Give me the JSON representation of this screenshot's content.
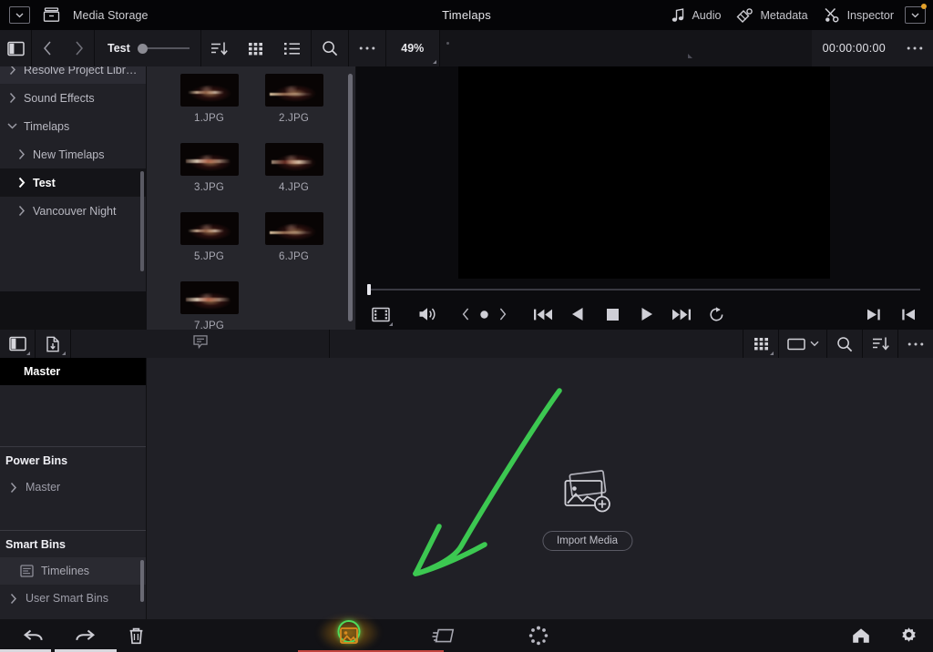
{
  "titlebar": {
    "dropdown_icon": "chevron-down-icon",
    "storage_icon": "media-storage-icon",
    "storage_label": "Media Storage",
    "title": "Timelaps",
    "right_items": [
      {
        "icon": "audio-note-icon",
        "label": "Audio"
      },
      {
        "icon": "metadata-icon",
        "label": "Metadata"
      },
      {
        "icon": "inspector-icon",
        "label": "Inspector"
      }
    ],
    "right_dropdown_icon": "chevron-down-icon",
    "notification_dot_color": "#e3a12a"
  },
  "toolbar_upper": {
    "sidebar_toggle_icon": "sidebar-toggle-icon",
    "back_icon": "chevron-left-icon",
    "forward_icon": "chevron-right-icon",
    "bin_name": "Test",
    "zoom_slider_value": "",
    "sort_icon": "sort-descending-icon",
    "grid_view_icon": "grid-view-icon",
    "list_view_icon": "list-view-icon",
    "search_icon": "search-icon",
    "more_icon": "more-options-icon",
    "zoom_level": "49%",
    "timecode": "00:00:00:00",
    "viewer_more_icon": "more-options-icon"
  },
  "library_tree": {
    "items": [
      {
        "label": "Resolve Project Libra...",
        "arrow": "chevron-right-icon",
        "indent": 1,
        "selected": false,
        "cut_off": true
      },
      {
        "label": "Sound Effects",
        "arrow": "chevron-right-icon",
        "indent": 1,
        "selected": false
      },
      {
        "label": "Timelaps",
        "arrow": "chevron-down-icon",
        "indent": 1,
        "selected": false
      },
      {
        "label": "New Timelaps",
        "arrow": "chevron-right-icon",
        "indent": 2,
        "selected": false
      },
      {
        "label": "Test",
        "arrow": "chevron-right-icon",
        "indent": 2,
        "selected": true
      },
      {
        "label": "Vancouver Night",
        "arrow": "chevron-right-icon",
        "indent": 2,
        "selected": false
      }
    ]
  },
  "thumbnails": {
    "rows": [
      [
        {
          "label": "1.JPG"
        },
        {
          "label": "2.JPG"
        }
      ],
      [
        {
          "label": "3.JPG"
        },
        {
          "label": "4.JPG"
        }
      ],
      [
        {
          "label": "5.JPG"
        },
        {
          "label": "6.JPG"
        }
      ],
      [
        {
          "label": "7.JPG"
        }
      ]
    ]
  },
  "viewer": {
    "transport": [
      {
        "icon": "film-strip-icon",
        "name": "timeline-view-button"
      },
      {
        "icon": "volume-icon",
        "name": "volume-button"
      },
      {
        "icon": "keyframe-prev-icon",
        "name": "prev-keyframe-button"
      },
      {
        "icon": "keyframe-dot-icon",
        "name": "add-keyframe-button"
      },
      {
        "icon": "keyframe-next-icon",
        "name": "next-keyframe-button"
      },
      {
        "icon": "skip-back-icon",
        "name": "jump-to-start-button"
      },
      {
        "icon": "play-reverse-icon",
        "name": "play-reverse-button"
      },
      {
        "icon": "stop-icon",
        "name": "stop-button"
      },
      {
        "icon": "play-icon",
        "name": "play-button"
      },
      {
        "icon": "skip-forward-icon",
        "name": "jump-to-end-button"
      },
      {
        "icon": "loop-icon",
        "name": "loop-button"
      }
    ],
    "right_controls": [
      {
        "icon": "mark-out-icon",
        "name": "mark-out-button"
      },
      {
        "icon": "mark-in-icon",
        "name": "mark-in-button"
      }
    ]
  },
  "toolbar_mid": {
    "sidebar_toggle_icon": "sidebar-toggle-icon",
    "import_file_icon": "import-file-icon",
    "tag_icon": "tag-bubble-icon",
    "grid_icon": "grid-view-icon",
    "view_mode_icon": "thumbnail-view-icon",
    "view_mode_chevron": "chevron-down-icon",
    "search_icon": "search-icon",
    "sort_icon": "sort-descending-icon",
    "more_icon": "more-options-icon"
  },
  "bins": {
    "master_label": "Master",
    "power_bins_title": "Power Bins",
    "power_bins_items": [
      {
        "label": "Master",
        "arrow": "chevron-right-icon"
      }
    ],
    "smart_bins_title": "Smart Bins",
    "smart_bins_items": [
      {
        "label": "Timelines",
        "icon": "timeline-bin-icon",
        "arrow": ""
      },
      {
        "label": "User Smart Bins",
        "arrow": "chevron-right-icon"
      }
    ]
  },
  "media_pool": {
    "import_icon": "import-media-image-icon",
    "import_label": "Import Media",
    "annotation": {
      "type": "hand-drawn-arrow",
      "color": "#3cc851",
      "direction": "down-left",
      "points_to": "import-media-button"
    }
  },
  "bottombar": {
    "undo_icon": "undo-icon",
    "redo_icon": "redo-icon",
    "delete_icon": "trash-icon",
    "pages": [
      {
        "icon": "media-page-icon",
        "name": "media-page-button",
        "active": true
      },
      {
        "icon": "cut-page-icon",
        "name": "cut-page-button",
        "active": false
      },
      {
        "icon": "color-page-icon",
        "name": "color-page-button",
        "active": false
      }
    ],
    "home_icon": "home-icon",
    "settings_icon": "gear-icon"
  },
  "colors": {
    "panel_bg": "#212127",
    "toolbar_bg": "#1a1a1f",
    "titlebar_bg": "#050507",
    "pool_bg": "#202026",
    "accent_green": "#3cc851",
    "accent_orange": "#e3a12a",
    "selection_bg": "#141418"
  }
}
